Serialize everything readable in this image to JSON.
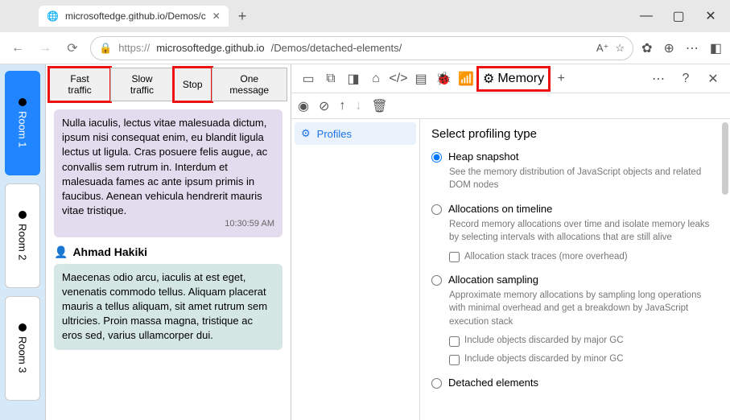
{
  "tab": {
    "title": "microsoftedge.github.io/Demos/c"
  },
  "address": {
    "protocol": "https://",
    "host": "microsoftedge.github.io",
    "path": "/Demos/detached-elements/"
  },
  "rooms": [
    {
      "label": "Room 1",
      "active": true
    },
    {
      "label": "Room 2",
      "active": false
    },
    {
      "label": "Room 3",
      "active": false
    }
  ],
  "chat_buttons": [
    {
      "label": "Fast traffic",
      "highlight": true
    },
    {
      "label": "Slow traffic",
      "highlight": false
    },
    {
      "label": "Stop",
      "highlight": true
    },
    {
      "label": "One message",
      "highlight": false
    }
  ],
  "messages": [
    {
      "author": "",
      "text": "Nulla iaculis, lectus vitae malesuada dictum, ipsum nisi consequat enim, eu blandit ligula lectus ut ligula. Cras posuere felis augue, ac convallis sem rutrum in. Interdum et malesuada fames ac ante ipsum primis in faucibus. Aenean vehicula hendrerit mauris vitae tristique.",
      "time": "10:30:59 AM",
      "style": "purple"
    },
    {
      "author": "Ahmad Hakiki",
      "text": "Maecenas odio arcu, iaculis at est eget, venenatis commodo tellus. Aliquam placerat mauris a tellus aliquam, sit amet rutrum sem ultricies. Proin massa magna, tristique ac eros sed, varius ullamcorper dui.",
      "time": "",
      "style": "teal"
    }
  ],
  "devtools": {
    "memory_label": "Memory",
    "profiles_label": "Profiles",
    "title": "Select profiling type",
    "options": [
      {
        "label": "Heap snapshot",
        "desc": "See the memory distribution of JavaScript objects and related DOM nodes",
        "checked": true
      },
      {
        "label": "Allocations on timeline",
        "desc": "Record memory allocations over time and isolate memory leaks by selecting intervals with allocations that are still alive",
        "checked": false,
        "subs": [
          {
            "label": "Allocation stack traces (more overhead)"
          }
        ]
      },
      {
        "label": "Allocation sampling",
        "desc": "Approximate memory allocations by sampling long operations with minimal overhead and get a breakdown by JavaScript execution stack",
        "checked": false,
        "subs": [
          {
            "label": "Include objects discarded by major GC"
          },
          {
            "label": "Include objects discarded by minor GC"
          }
        ]
      },
      {
        "label": "Detached elements",
        "desc": "",
        "checked": false
      }
    ]
  }
}
